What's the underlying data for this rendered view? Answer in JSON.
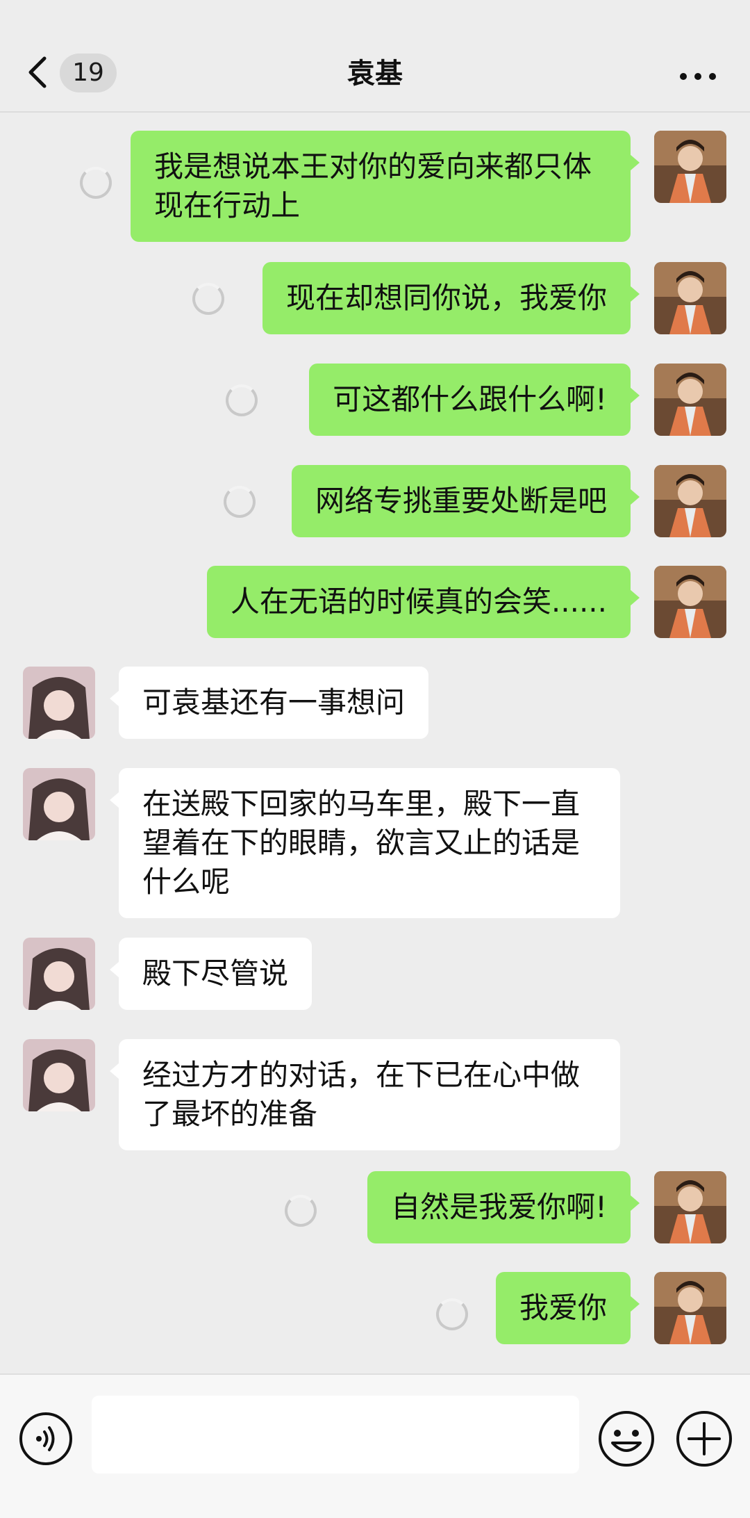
{
  "header": {
    "unread_count": "19",
    "title": "袁基"
  },
  "icons": {
    "back": "chevron-left-icon",
    "more": "more-horizontal-icon",
    "voice": "voice-icon",
    "emoji": "emoji-icon",
    "plus": "plus-circle-icon"
  },
  "colors": {
    "outgoing_bubble": "#95ec69",
    "incoming_bubble": "#ffffff",
    "background": "#ededed"
  },
  "messages": [
    {
      "side": "out",
      "status": "sending",
      "text": "我是想说本王对你的爱向来都只体现在行动上"
    },
    {
      "side": "out",
      "status": "sending",
      "text": "现在却想同你说，我爱你"
    },
    {
      "side": "out",
      "status": "sending",
      "text": "可这都什么跟什么啊!"
    },
    {
      "side": "out",
      "status": "sending",
      "text": "网络专挑重要处断是吧"
    },
    {
      "side": "out",
      "status": "sent",
      "text": "人在无语的时候真的会笑......"
    },
    {
      "side": "in",
      "text": "可袁基还有一事想问"
    },
    {
      "side": "in",
      "text": "在送殿下回家的马车里，殿下一直望着在下的眼睛，欲言又止的话是什么呢"
    },
    {
      "side": "in",
      "text": "殿下尽管说"
    },
    {
      "side": "in",
      "text": "经过方才的对话，在下已在心中做了最坏的准备"
    },
    {
      "side": "out",
      "status": "sending",
      "text": "自然是我爱你啊!"
    },
    {
      "side": "out",
      "status": "sending",
      "text": "我爱你"
    }
  ],
  "input": {
    "value": "",
    "placeholder": ""
  }
}
